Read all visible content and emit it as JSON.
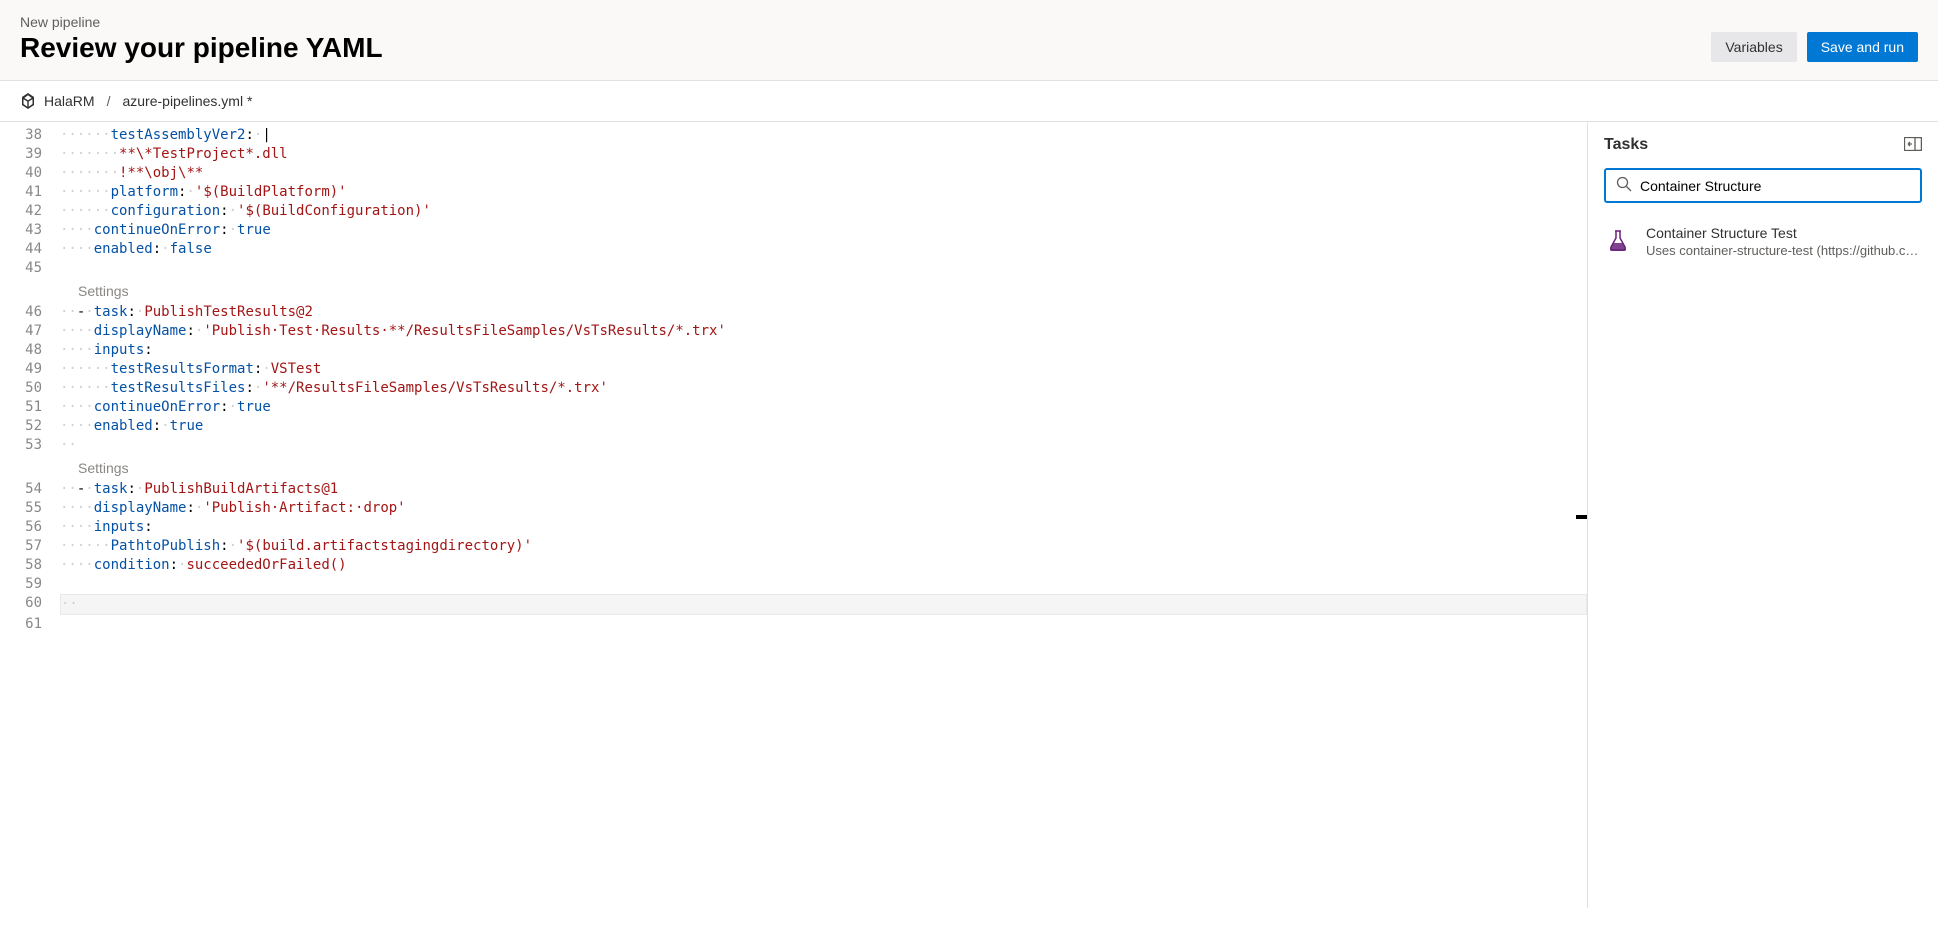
{
  "header": {
    "breadcrumb": "New pipeline",
    "title": "Review your pipeline YAML",
    "variables_btn": "Variables",
    "save_run_btn": "Save and run"
  },
  "path": {
    "repo": "HalaRM",
    "sep": "/",
    "file": "azure-pipelines.yml *"
  },
  "editor": {
    "settings_label": "Settings",
    "lines": [
      {
        "n": 38,
        "ws": "······",
        "html": "<span class='tok-key'>testAssemblyVer2</span><span class='tok-punc'>:</span><span class='tok-ws'>·</span><span class='tok-punc'>|</span>"
      },
      {
        "n": 39,
        "ws": "·······",
        "html": "<span class='tok-str'>**\\*TestProject*.dll</span>"
      },
      {
        "n": 40,
        "ws": "·······",
        "html": "<span class='tok-str'>!**\\obj\\**</span>"
      },
      {
        "n": 41,
        "ws": "······",
        "html": "<span class='tok-key'>platform</span><span class='tok-punc'>:</span><span class='tok-ws'>·</span><span class='tok-str'>'$(BuildPlatform)'</span>"
      },
      {
        "n": 42,
        "ws": "······",
        "html": "<span class='tok-key'>configuration</span><span class='tok-punc'>:</span><span class='tok-ws'>·</span><span class='tok-str'>'$(BuildConfiguration)'</span>"
      },
      {
        "n": 43,
        "ws": "····",
        "html": "<span class='tok-key'>continueOnError</span><span class='tok-punc'>:</span><span class='tok-ws'>·</span><span class='tok-bool'>true</span>"
      },
      {
        "n": 44,
        "ws": "····",
        "html": "<span class='tok-key'>enabled</span><span class='tok-punc'>:</span><span class='tok-ws'>·</span><span class='tok-bool'>false</span>"
      },
      {
        "n": 45,
        "ws": "",
        "html": ""
      },
      {
        "settings": true
      },
      {
        "n": 46,
        "ws": "··",
        "html": "<span class='tok-punc'>-</span><span class='tok-ws'>·</span><span class='tok-key'>task</span><span class='tok-punc'>:</span><span class='tok-ws'>·</span><span class='tok-str'>PublishTestResults@2</span>"
      },
      {
        "n": 47,
        "ws": "····",
        "html": "<span class='tok-key'>displayName</span><span class='tok-punc'>:</span><span class='tok-ws'>·</span><span class='tok-str'>'Publish·Test·Results·**/ResultsFileSamples/VsTsResults/*.trx'</span>"
      },
      {
        "n": 48,
        "ws": "····",
        "html": "<span class='tok-key'>inputs</span><span class='tok-punc'>:</span>"
      },
      {
        "n": 49,
        "ws": "······",
        "html": "<span class='tok-key'>testResultsFormat</span><span class='tok-punc'>:</span><span class='tok-ws'>·</span><span class='tok-str'>VSTest</span>"
      },
      {
        "n": 50,
        "ws": "······",
        "html": "<span class='tok-key'>testResultsFiles</span><span class='tok-punc'>:</span><span class='tok-ws'>·</span><span class='tok-str'>'**/ResultsFileSamples/VsTsResults/*.trx'</span>"
      },
      {
        "n": 51,
        "ws": "····",
        "html": "<span class='tok-key'>continueOnError</span><span class='tok-punc'>:</span><span class='tok-ws'>·</span><span class='tok-bool'>true</span>"
      },
      {
        "n": 52,
        "ws": "····",
        "html": "<span class='tok-key'>enabled</span><span class='tok-punc'>:</span><span class='tok-ws'>·</span><span class='tok-bool'>true</span>"
      },
      {
        "n": 53,
        "ws": "··",
        "html": ""
      },
      {
        "settings": true
      },
      {
        "n": 54,
        "ws": "··",
        "html": "<span class='tok-punc'>-</span><span class='tok-ws'>·</span><span class='tok-key'>task</span><span class='tok-punc'>:</span><span class='tok-ws'>·</span><span class='tok-str'>PublishBuildArtifacts@1</span>"
      },
      {
        "n": 55,
        "ws": "····",
        "html": "<span class='tok-key'>displayName</span><span class='tok-punc'>:</span><span class='tok-ws'>·</span><span class='tok-str'>'Publish·Artifact:·drop'</span>"
      },
      {
        "n": 56,
        "ws": "····",
        "html": "<span class='tok-key'>inputs</span><span class='tok-punc'>:</span>"
      },
      {
        "n": 57,
        "ws": "······",
        "html": "<span class='tok-key'>PathtoPublish</span><span class='tok-punc'>:</span><span class='tok-ws'>·</span><span class='tok-str'>'$(build.artifactstagingdirectory)'</span>"
      },
      {
        "n": 58,
        "ws": "····",
        "html": "<span class='tok-key'>condition</span><span class='tok-punc'>:</span><span class='tok-ws'>·</span><span class='tok-str'>succeededOrFailed()</span>"
      },
      {
        "n": 59,
        "ws": "",
        "html": ""
      },
      {
        "n": 60,
        "ws": "··",
        "html": "",
        "current": true
      },
      {
        "n": 61,
        "ws": "",
        "html": ""
      }
    ]
  },
  "tasks": {
    "title": "Tasks",
    "search_value": "Container Structure",
    "results": [
      {
        "name": "Container Structure Test",
        "desc": "Uses container-structure-test (https://github.com..."
      }
    ]
  }
}
